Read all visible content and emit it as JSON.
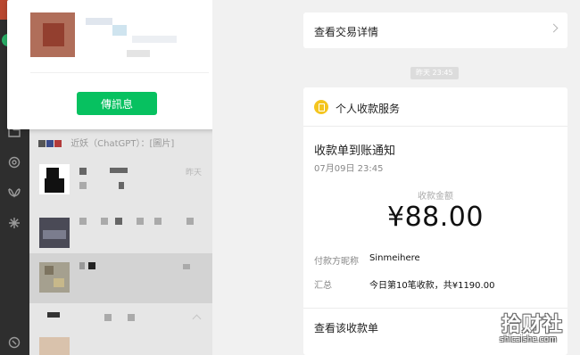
{
  "popup": {
    "message_button": "傳訊息"
  },
  "chat_list": {
    "rows": [
      {
        "preview": "近妖（ChatGPT）：[圖片]",
        "time": "昨天"
      }
    ]
  },
  "main": {
    "detail_link": "查看交易详情",
    "time_chip": "昨天 23:45",
    "service_title": "个人收款服务",
    "notice_title": "收款单到账通知",
    "notice_time": "07月09日 23:45",
    "amount_label": "收款金额",
    "amount": "¥88.00",
    "payer_label": "付款方昵称",
    "payer_value": "Sinmeihere",
    "summary_label": "汇总",
    "summary_value": "今日第10笔收款，共¥1190.00",
    "view_bill": "查看该收款单"
  },
  "watermark": {
    "text": "拾财社",
    "url": "shicaishe.com"
  },
  "colors": {
    "accent_green": "#07c160",
    "rail_bg": "#2e2e2e",
    "service_icon": "#f4c51f"
  }
}
